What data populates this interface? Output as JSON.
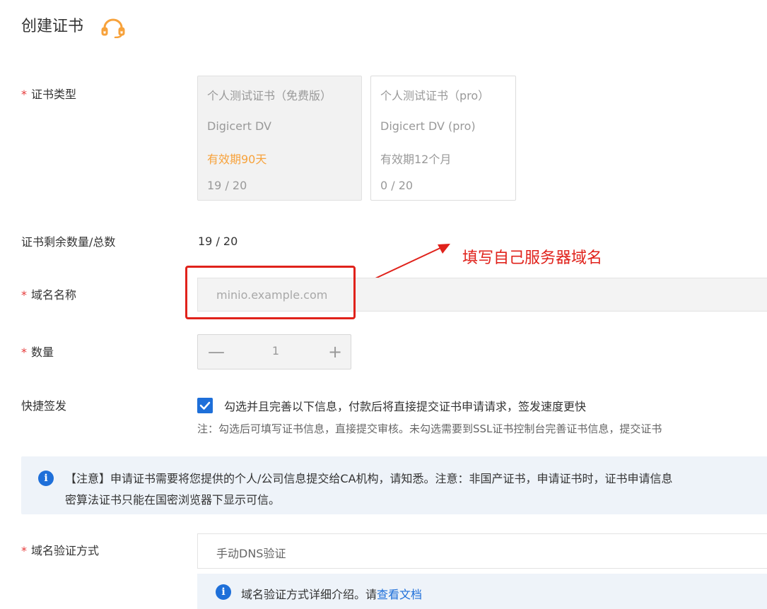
{
  "page": {
    "title": "创建证书"
  },
  "fields": {
    "cert_type_label": "证书类型",
    "remaining_label": "证书剩余数量/总数",
    "remaining_value": "19 / 20",
    "domain_label": "域名名称",
    "quantity_label": "数量",
    "quick_issue_label": "快捷签发",
    "verify_method_label": "域名验证方式",
    "required_mark": "*"
  },
  "cert_options": [
    {
      "name": "个人测试证书（免费版）",
      "brand": "Digicert DV",
      "validity": "有效期90天",
      "count": "19 / 20"
    },
    {
      "name": "个人测试证书（pro）",
      "brand": "Digicert DV (pro)",
      "validity": "有效期12个月",
      "count": "0 / 20"
    }
  ],
  "domain": {
    "placeholder": "minio.example.com"
  },
  "annotation": {
    "text": "填写自己服务器域名"
  },
  "quantity": {
    "value": "1",
    "minus": "—",
    "plus": "+"
  },
  "quick_issue": {
    "checked": true,
    "text": "勾选并且完善以下信息，付款后将直接提交证书申请请求，签发速度更快",
    "note": "注：勾选后可填写证书信息，直接提交审核。未勾选需要到SSL证书控制台完善证书信息，提交证书"
  },
  "notice": {
    "line1": "【注意】申请证书需要将您提供的个人/公司信息提交给CA机构，请知悉。注意：非国产证书，申请证书时，证书申请信息",
    "line2": "密算法证书只能在国密浏览器下显示可信。"
  },
  "verify": {
    "value": "手动DNS验证",
    "info_text": "域名验证方式详细介绍。请",
    "info_link": "查看文档"
  },
  "colors": {
    "accent": "#1e6fd9",
    "orange": "#f7a23b",
    "annotation_red": "#e0221b",
    "required_red": "#e63a3a"
  }
}
